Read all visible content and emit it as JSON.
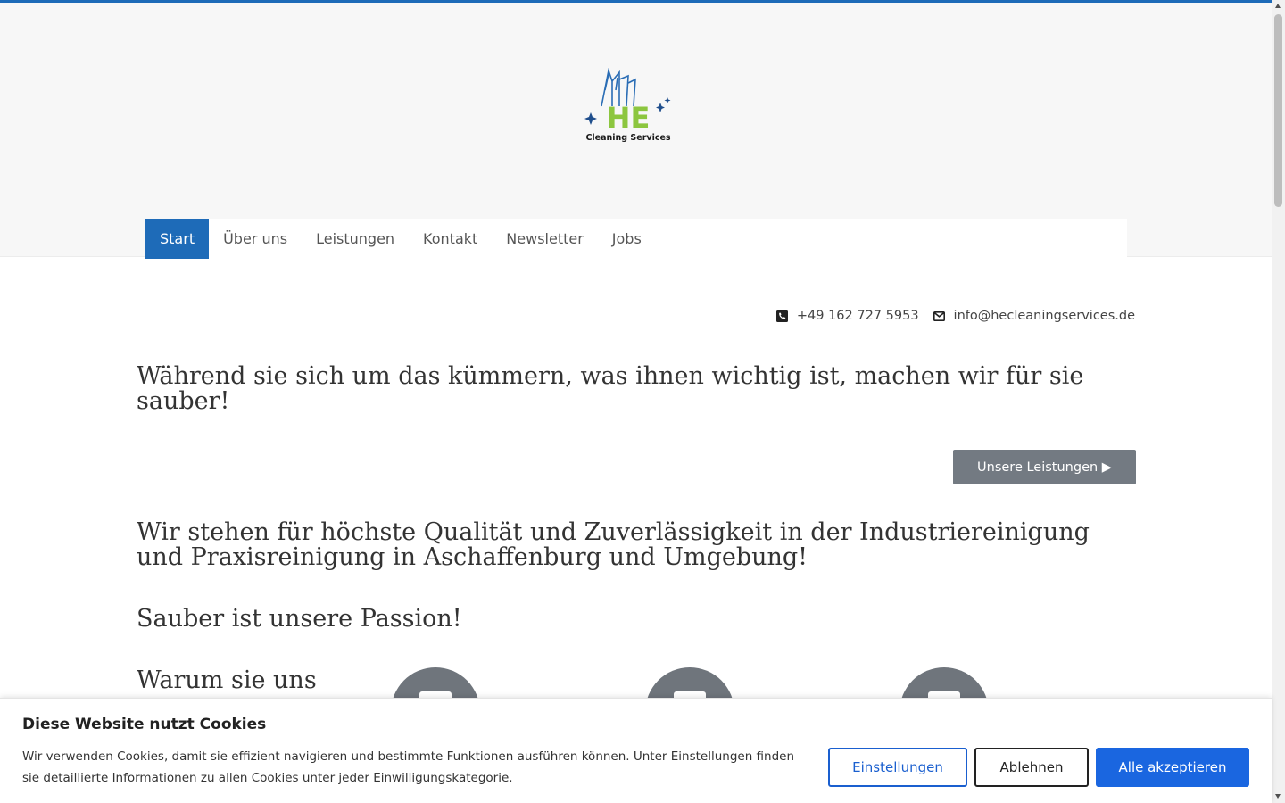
{
  "brand": {
    "logo_text": "HE",
    "logo_subtitle": "Cleaning Services",
    "colors": {
      "primary": "#1e6bb8",
      "logo_green": "#8cc63f",
      "logo_blue": "#2a6db5",
      "button_gray": "#737a82"
    }
  },
  "nav": {
    "items": [
      {
        "label": "Start",
        "active": true
      },
      {
        "label": "Über uns",
        "active": false
      },
      {
        "label": "Leistungen",
        "active": false
      },
      {
        "label": "Kontakt",
        "active": false
      },
      {
        "label": "Newsletter",
        "active": false
      },
      {
        "label": "Jobs",
        "active": false
      }
    ]
  },
  "contact": {
    "phone": "+49 162 727 5953",
    "email": "info@hecleaningservices.de",
    "phone_icon": "phone-icon",
    "email_icon": "envelope-icon"
  },
  "main": {
    "hero_heading": "Während sie sich um das kümmern, was ihnen wichtig ist, machen wir für sie sauber!",
    "services_button": "Unsere Leistungen ▶",
    "quality_heading": "Wir stehen für höchste Qualität und Zuverlässigkeit in der Industriereinigung und Praxisreinigung in Aschaffenburg und Umgebung!",
    "passion_heading": "Sauber ist unsere Passion!",
    "why_heading": "Warum sie uns"
  },
  "cookie_banner": {
    "title": "Diese Website nutzt Cookies",
    "text": "Wir verwenden Cookies, damit sie effizient navigieren und bestimmte Funktionen ausführen können. Unter Einstellungen finden sie detaillierte Informationen zu allen Cookies unter jeder Einwilligungskategorie.",
    "settings_label": "Einstellungen",
    "reject_label": "Ablehnen",
    "accept_label": "Alle akzeptieren"
  }
}
